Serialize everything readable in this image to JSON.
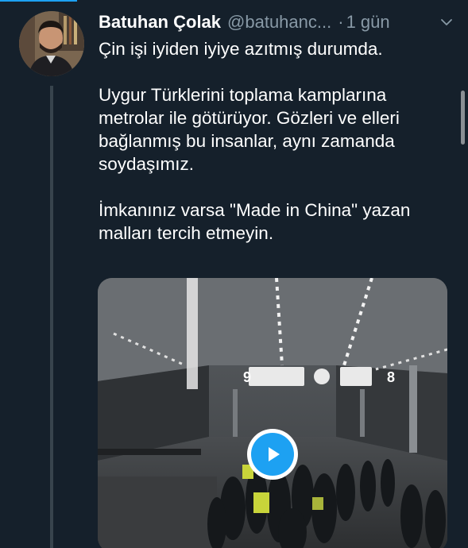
{
  "tweet": {
    "author_name": "Batuhan Çolak",
    "author_handle": "@batuhanc...",
    "separator": "·",
    "timestamp": "1 gün",
    "paragraphs": [
      "Çin işi iyiden iyiye azıtmış durumda.",
      "Uygur Türklerini toplama kamplarına metrolar ile götürüyor. Gözleri ve elleri bağlanmış bu insanlar, aynı zamanda soydaşımız.",
      "İmkanınız varsa \"Made in China\" yazan malları tercih etmeyin."
    ],
    "media": {
      "type": "video",
      "platform_sign_numbers": [
        "9",
        "8"
      ]
    }
  },
  "icons": {
    "menu": "chevron-down-icon",
    "play": "play-icon"
  },
  "colors": {
    "background": "#15202b",
    "accent": "#1da1f2",
    "secondary_text": "#8899a6",
    "thread_line": "#38444d"
  }
}
